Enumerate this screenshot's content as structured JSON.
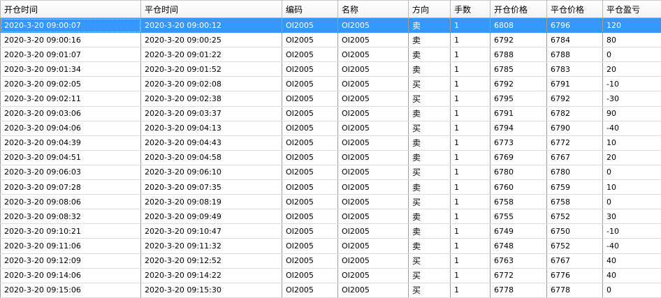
{
  "columns": [
    "开仓时间",
    "平仓时间",
    "编码",
    "名称",
    "方向",
    "手数",
    "开仓价格",
    "平仓价格",
    "平仓盈亏"
  ],
  "selected_row": 0,
  "rows": [
    [
      "2020-3-20 09:00:07",
      "2020-3-20 09:00:12",
      "OI2005",
      "OI2005",
      "卖",
      "1",
      "6808",
      "6796",
      "120"
    ],
    [
      "2020-3-20 09:00:16",
      "2020-3-20 09:00:25",
      "OI2005",
      "OI2005",
      "卖",
      "1",
      "6792",
      "6784",
      "80"
    ],
    [
      "2020-3-20 09:01:07",
      "2020-3-20 09:01:22",
      "OI2005",
      "OI2005",
      "卖",
      "1",
      "6788",
      "6788",
      "0"
    ],
    [
      "2020-3-20 09:01:34",
      "2020-3-20 09:01:52",
      "OI2005",
      "OI2005",
      "卖",
      "1",
      "6785",
      "6783",
      "20"
    ],
    [
      "2020-3-20 09:02:05",
      "2020-3-20 09:02:08",
      "OI2005",
      "OI2005",
      "买",
      "1",
      "6792",
      "6791",
      "-10"
    ],
    [
      "2020-3-20 09:02:11",
      "2020-3-20 09:02:38",
      "OI2005",
      "OI2005",
      "买",
      "1",
      "6795",
      "6792",
      "-30"
    ],
    [
      "2020-3-20 09:03:06",
      "2020-3-20 09:03:37",
      "OI2005",
      "OI2005",
      "卖",
      "1",
      "6791",
      "6782",
      "90"
    ],
    [
      "2020-3-20 09:04:06",
      "2020-3-20 09:04:13",
      "OI2005",
      "OI2005",
      "买",
      "1",
      "6794",
      "6790",
      "-40"
    ],
    [
      "2020-3-20 09:04:39",
      "2020-3-20 09:04:43",
      "OI2005",
      "OI2005",
      "卖",
      "1",
      "6773",
      "6772",
      "10"
    ],
    [
      "2020-3-20 09:04:51",
      "2020-3-20 09:04:58",
      "OI2005",
      "OI2005",
      "卖",
      "1",
      "6769",
      "6767",
      "20"
    ],
    [
      "2020-3-20 09:06:03",
      "2020-3-20 09:06:10",
      "OI2005",
      "OI2005",
      "买",
      "1",
      "6780",
      "6780",
      "0"
    ],
    [
      "2020-3-20 09:07:28",
      "2020-3-20 09:07:35",
      "OI2005",
      "OI2005",
      "卖",
      "1",
      "6760",
      "6759",
      "10"
    ],
    [
      "2020-3-20 09:08:06",
      "2020-3-20 09:08:19",
      "OI2005",
      "OI2005",
      "买",
      "1",
      "6758",
      "6758",
      "0"
    ],
    [
      "2020-3-20 09:08:32",
      "2020-3-20 09:09:49",
      "OI2005",
      "OI2005",
      "卖",
      "1",
      "6755",
      "6752",
      "30"
    ],
    [
      "2020-3-20 09:10:21",
      "2020-3-20 09:10:47",
      "OI2005",
      "OI2005",
      "卖",
      "1",
      "6749",
      "6750",
      "-10"
    ],
    [
      "2020-3-20 09:11:06",
      "2020-3-20 09:11:32",
      "OI2005",
      "OI2005",
      "卖",
      "1",
      "6748",
      "6752",
      "-40"
    ],
    [
      "2020-3-20 09:12:09",
      "2020-3-20 09:12:52",
      "OI2005",
      "OI2005",
      "买",
      "1",
      "6763",
      "6767",
      "40"
    ],
    [
      "2020-3-20 09:14:06",
      "2020-3-20 09:14:22",
      "OI2005",
      "OI2005",
      "买",
      "1",
      "6772",
      "6776",
      "40"
    ],
    [
      "2020-3-20 09:15:06",
      "2020-3-20 09:15:30",
      "OI2005",
      "OI2005",
      "买",
      "1",
      "6778",
      "6778",
      "0"
    ]
  ]
}
